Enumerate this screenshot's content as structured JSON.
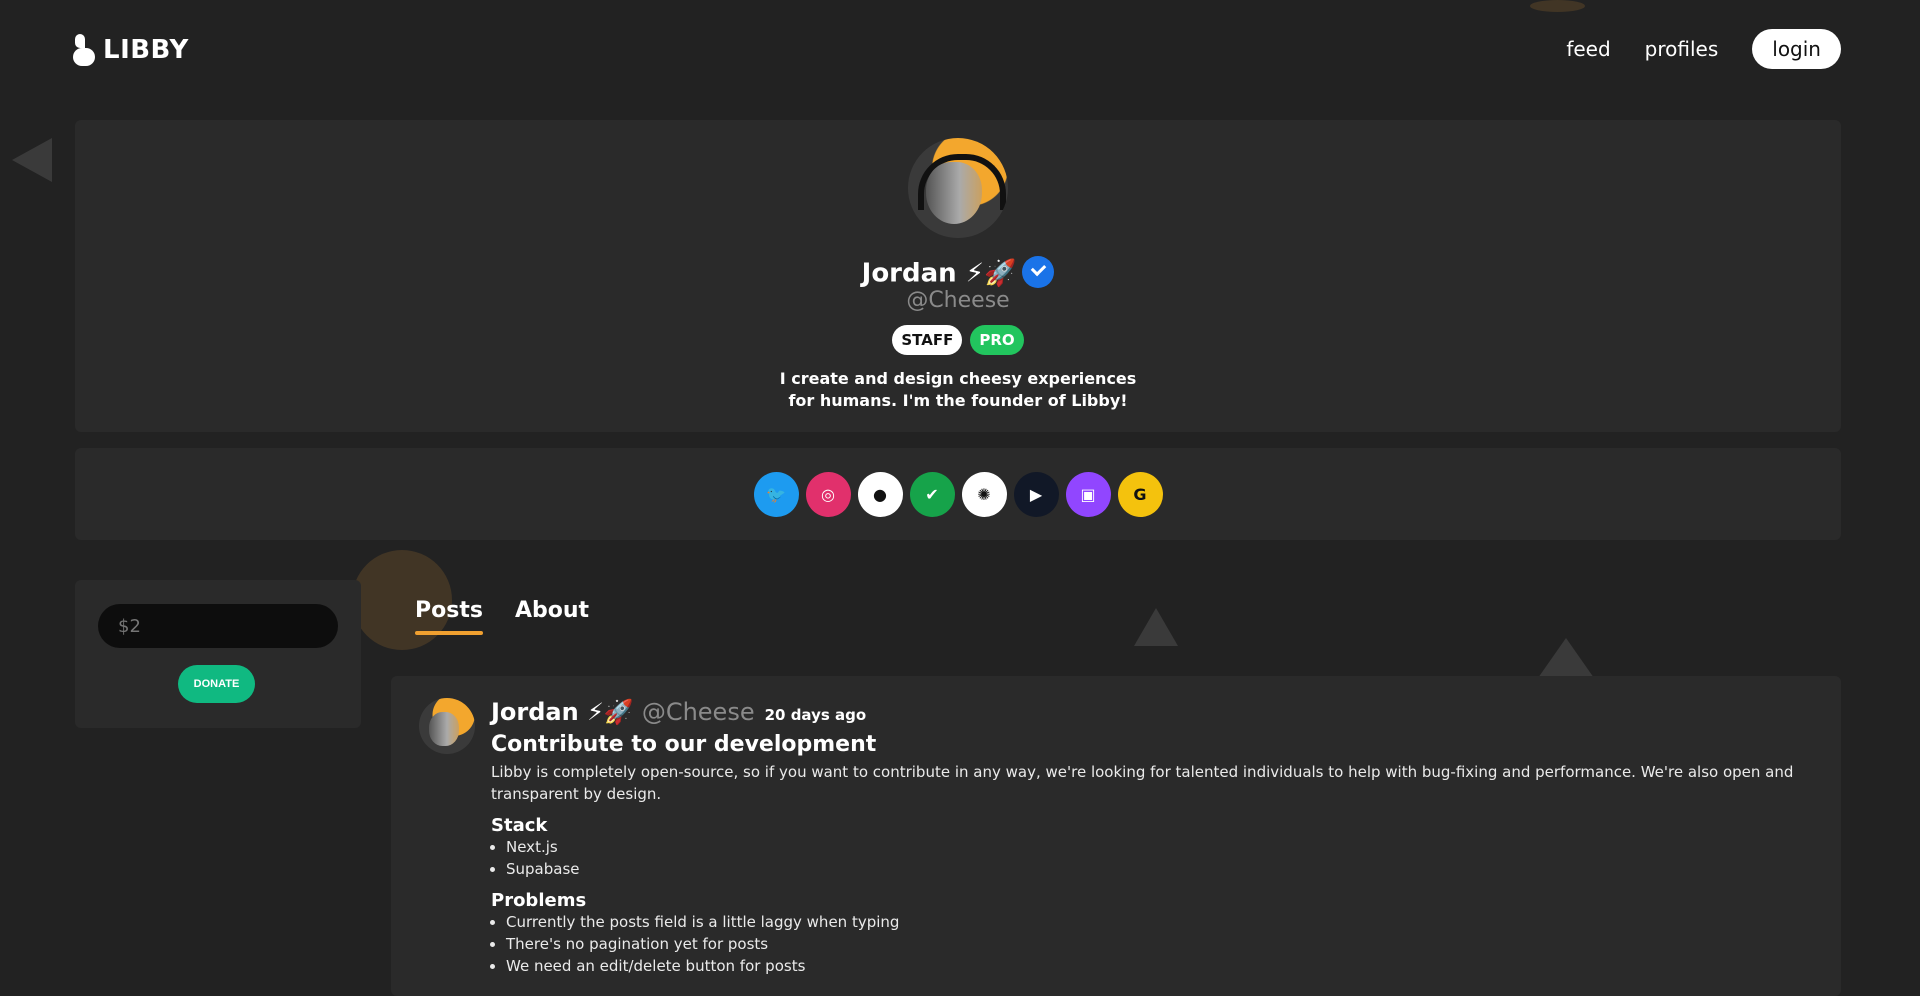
{
  "header": {
    "brand": "LIBBY",
    "nav": [
      {
        "label": "feed"
      },
      {
        "label": "profiles"
      }
    ],
    "login_label": "login"
  },
  "profile": {
    "name": "Jordan ⚡🚀",
    "handle": "@Cheese",
    "badges": [
      "STAFF",
      "PRO"
    ],
    "bio_lines": [
      "I create and design cheesy experiences",
      "for humans. I'm the founder of Libby!"
    ]
  },
  "socials": [
    {
      "icon": "twitter-icon",
      "color": "#1d9bf0",
      "glyph": "🐦"
    },
    {
      "icon": "instagram-icon",
      "color": "#e1306c",
      "glyph": "◎"
    },
    {
      "icon": "github-icon",
      "color": "#ffffff",
      "glyph": "●"
    },
    {
      "icon": "checkmark-icon",
      "color": "#16a34a",
      "glyph": "✔"
    },
    {
      "icon": "sun-icon",
      "color": "#ffffff",
      "glyph": "✺"
    },
    {
      "icon": "play-icon",
      "color": "#111827",
      "glyph": "▶"
    },
    {
      "icon": "twitch-icon",
      "color": "#9146ff",
      "glyph": "▣"
    },
    {
      "icon": "gumroad-icon",
      "color": "#f4c20d",
      "glyph": "G"
    }
  ],
  "donate": {
    "placeholder": "$2",
    "button": "DONATE"
  },
  "tabs": [
    {
      "label": "Posts",
      "active": true
    },
    {
      "label": "About",
      "active": false
    }
  ],
  "post": {
    "author": "Jordan ⚡🚀",
    "handle": "@Cheese",
    "time": "20 days ago",
    "title": "Contribute to our development",
    "text": "Libby is completely open-source, so if you want to contribute in any way, we're looking for talented individuals to help with bug-fixing and performance. We're also open and transparent by design.",
    "sections": [
      {
        "heading": "Stack",
        "items": [
          "Next.js",
          "Supabase"
        ]
      },
      {
        "heading": "Problems",
        "items": [
          "Currently the posts field is a little laggy when typing",
          "There's no pagination yet for posts",
          "We need an edit/delete button for posts"
        ]
      }
    ]
  },
  "colors": {
    "background": "#222222",
    "card": "#2a2a2a",
    "accent": "#f0a030",
    "verified": "#1a73e8",
    "pro": "#22c55e",
    "donate": "#10b981"
  }
}
